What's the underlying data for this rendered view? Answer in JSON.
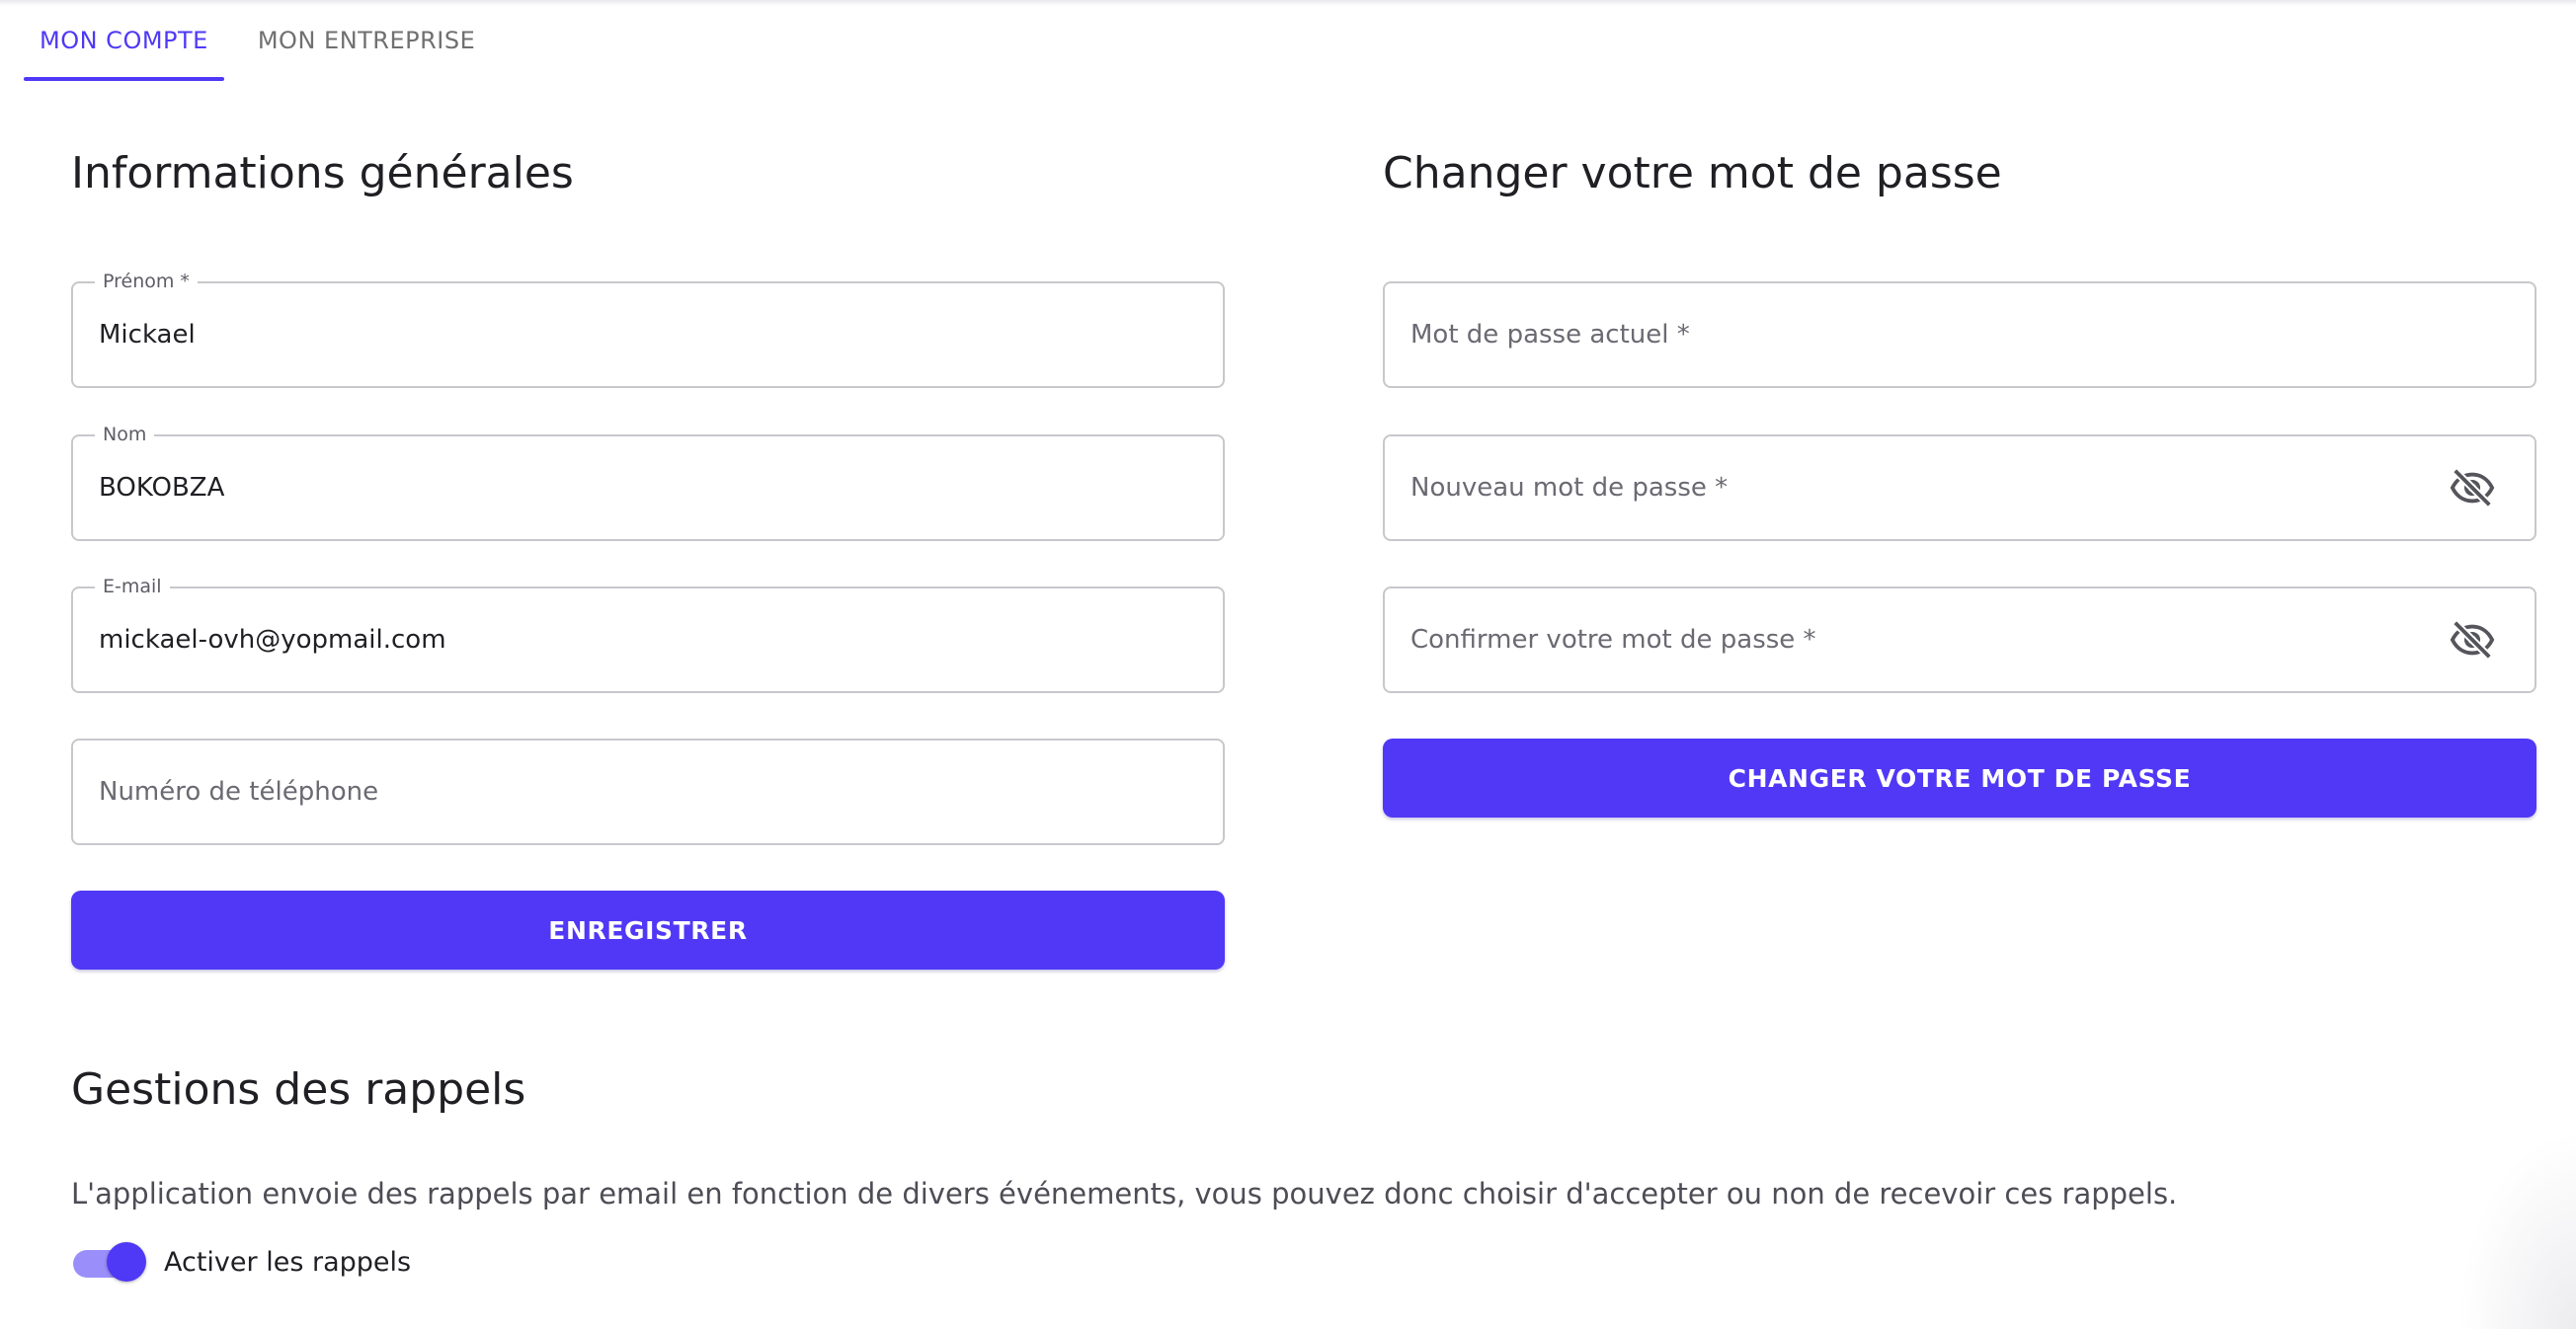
{
  "tabs": [
    {
      "label": "MON COMPTE",
      "active": true
    },
    {
      "label": "MON ENTREPRISE",
      "active": false
    }
  ],
  "general": {
    "title": "Informations générales",
    "first_name": {
      "label": "Prénom *",
      "value": "Mickael"
    },
    "last_name": {
      "label": "Nom",
      "value": "BOKOBZA"
    },
    "email": {
      "label": "E-mail",
      "value": "mickael-ovh@yopmail.com"
    },
    "phone": {
      "placeholder": "Numéro de téléphone",
      "value": ""
    },
    "save_label": "ENREGISTRER"
  },
  "password": {
    "title": "Changer votre mot de passe",
    "current": {
      "placeholder": "Mot de passe actuel *"
    },
    "new": {
      "placeholder": "Nouveau mot de passe *",
      "icon": "eye-off-icon"
    },
    "confirm": {
      "placeholder": "Confirmer votre mot de passe *",
      "icon": "eye-off-icon"
    },
    "submit_label": "CHANGER VOTRE MOT DE PASSE"
  },
  "reminders": {
    "title": "Gestions des rappels",
    "description": "L'application envoie des rappels par email en fonction de divers événements, vous pouvez donc choisir d'accepter ou non de recevoir ces rappels.",
    "toggle_label": "Activer les rappels",
    "enabled": true
  },
  "colors": {
    "accent": "#4f39f6",
    "text": "#1f1f24",
    "muted_text": "#707070",
    "border": "#c8c8cc"
  }
}
